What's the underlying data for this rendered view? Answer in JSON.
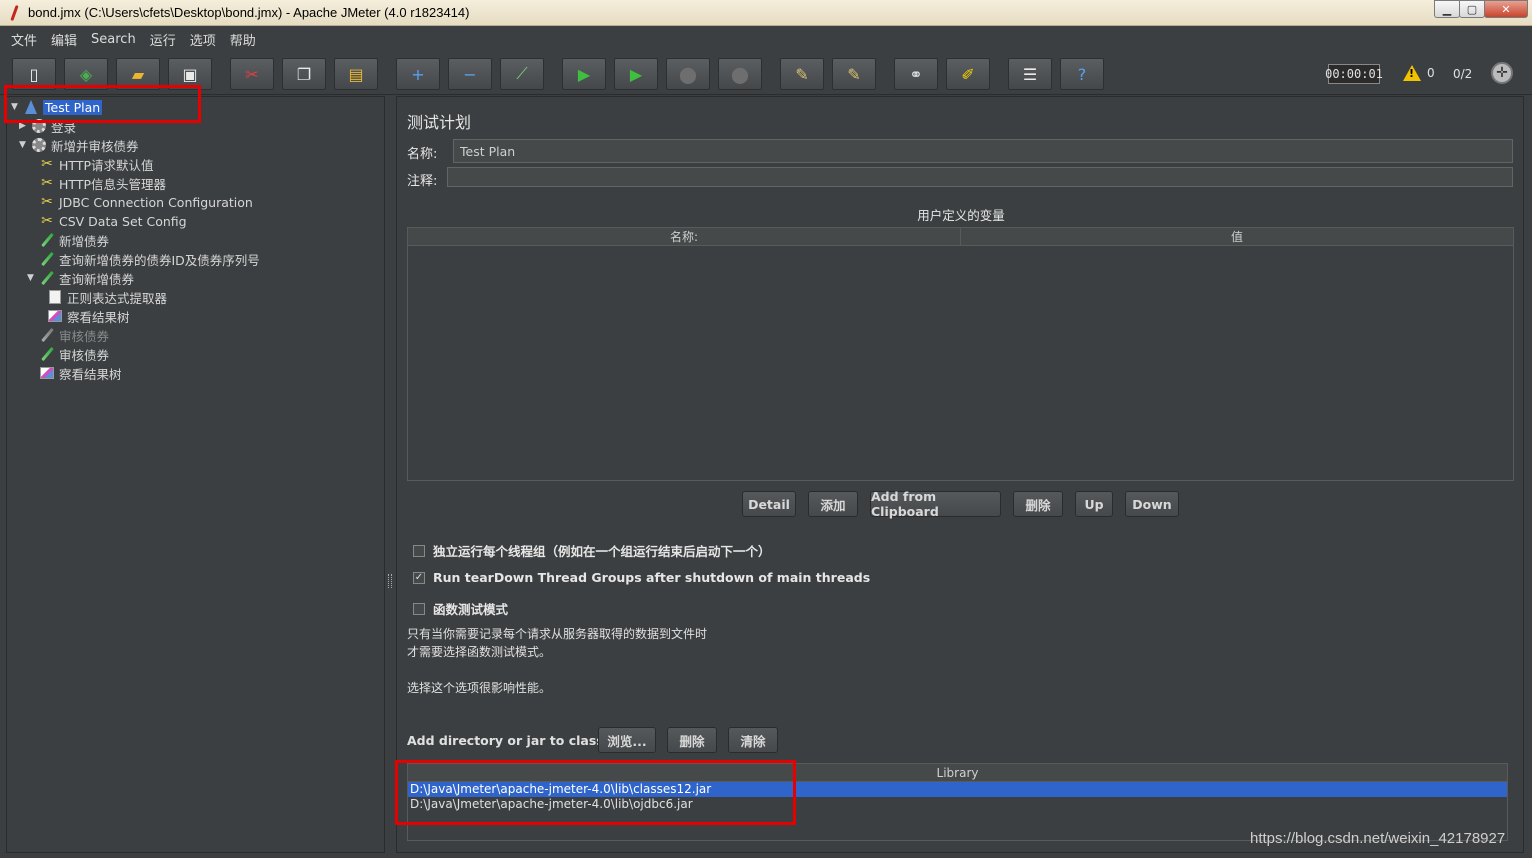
{
  "window": {
    "title": "bond.jmx (C:\\Users\\cfets\\Desktop\\bond.jmx) - Apache JMeter (4.0 r1823414)"
  },
  "menu": [
    "文件",
    "编辑",
    "Search",
    "运行",
    "选项",
    "帮助"
  ],
  "toolbar": {
    "buttons": [
      {
        "name": "new-icon",
        "glyph": "▯",
        "color": "#f0f0f0"
      },
      {
        "name": "templates-icon",
        "glyph": "◈",
        "color": "#4caf50"
      },
      {
        "name": "open-icon",
        "glyph": "▰",
        "color": "#e8b630"
      },
      {
        "name": "save-icon",
        "glyph": "▣",
        "color": "#eaeaea"
      },
      {
        "name": "cut-icon",
        "glyph": "✂",
        "color": "#e04040"
      },
      {
        "name": "copy-icon",
        "glyph": "❐",
        "color": "#eaeaea"
      },
      {
        "name": "paste-icon",
        "glyph": "▤",
        "color": "#e8b630"
      },
      {
        "name": "expand-icon",
        "glyph": "+",
        "color": "#5aa0f0"
      },
      {
        "name": "collapse-icon",
        "glyph": "−",
        "color": "#5aa0f0"
      },
      {
        "name": "toggle-icon",
        "glyph": "⟋",
        "color": "#7ad07f"
      },
      {
        "name": "start-icon",
        "glyph": "▶",
        "color": "#3fbf3f"
      },
      {
        "name": "start-no-pause-icon",
        "glyph": "▶",
        "color": "#3fbf3f"
      },
      {
        "name": "stop-icon",
        "glyph": "⬤",
        "color": "#6e6e6e"
      },
      {
        "name": "shutdown-icon",
        "glyph": "⬤",
        "color": "#6e6e6e"
      },
      {
        "name": "clear-icon",
        "glyph": "✎",
        "color": "#d8c070"
      },
      {
        "name": "clear-all-icon",
        "glyph": "✎",
        "color": "#d8c070"
      },
      {
        "name": "search-icon",
        "glyph": "⚭",
        "color": "#e0e0e0"
      },
      {
        "name": "reset-search-icon",
        "glyph": "✐",
        "color": "#f2d400"
      },
      {
        "name": "function-helper-icon",
        "glyph": "☰",
        "color": "#eaeaea"
      },
      {
        "name": "help-icon",
        "glyph": "?",
        "color": "#5aa0f0"
      }
    ],
    "timer": "00:00:01",
    "warnings": "0",
    "threads": "0/2"
  },
  "tree": [
    {
      "label": "Test Plan",
      "icon": "flask",
      "level": 0,
      "toggle": "▼",
      "selected": true
    },
    {
      "label": "登录",
      "icon": "gear",
      "level": 1,
      "toggle": "▶"
    },
    {
      "label": "新增并审核债券",
      "icon": "gear",
      "level": 1,
      "toggle": "▼"
    },
    {
      "label": "HTTP请求默认值",
      "icon": "scissors",
      "level": 2
    },
    {
      "label": "HTTP信息头管理器",
      "icon": "scissors",
      "level": 2
    },
    {
      "label": "JDBC Connection Configuration",
      "icon": "scissors",
      "level": 2
    },
    {
      "label": "CSV Data Set Config",
      "icon": "scissors",
      "level": 2
    },
    {
      "label": "新增债券",
      "icon": "pipette",
      "level": 2
    },
    {
      "label": "查询新增债券的债券ID及债券序列号",
      "icon": "pipette",
      "level": 2
    },
    {
      "label": "查询新增债券",
      "icon": "pipette",
      "level": 2,
      "toggle": "▼"
    },
    {
      "label": "正则表达式提取器",
      "icon": "doc",
      "level": 3
    },
    {
      "label": "察看结果树",
      "icon": "graph",
      "level": 3
    },
    {
      "label": "审核债券",
      "icon": "pipette-grey",
      "level": 2,
      "disabled": true
    },
    {
      "label": "审核债券",
      "icon": "pipette",
      "level": 2
    },
    {
      "label": "察看结果树",
      "icon": "graph",
      "level": 2
    }
  ],
  "panel": {
    "title": "测试计划",
    "name_label": "名称:",
    "name_value": "Test Plan",
    "comment_label": "注释:",
    "comment_value": "",
    "vars_caption": "用户定义的变量",
    "vars_col_name": "名称:",
    "vars_col_value": "值",
    "buttons": {
      "detail": "Detail",
      "add": "添加",
      "add_clipboard": "Add from Clipboard",
      "delete": "删除",
      "up": "Up",
      "down": "Down"
    },
    "checkboxes": {
      "serialize": "独立运行每个线程组（例如在一个组运行结束后启动下一个）",
      "teardown": "Run tearDown Thread Groups after shutdown of main threads",
      "functional": "函数测试模式"
    },
    "notes": {
      "line1": "只有当你需要记录每个请求从服务器取得的数据到文件时",
      "line2": "才需要选择函数测试模式。",
      "line3": "选择这个选项很影响性能。"
    },
    "classpath_label": "Add directory or jar to classpath",
    "classpath_buttons": {
      "browse": "浏览...",
      "delete": "删除",
      "clear": "清除"
    },
    "library_header": "Library",
    "library_rows": [
      "D:\\Java\\Jmeter\\apache-jmeter-4.0\\lib\\classes12.jar",
      "D:\\Java\\Jmeter\\apache-jmeter-4.0\\lib\\ojdbc6.jar"
    ]
  },
  "watermark": "https://blog.csdn.net/weixin_42178927"
}
